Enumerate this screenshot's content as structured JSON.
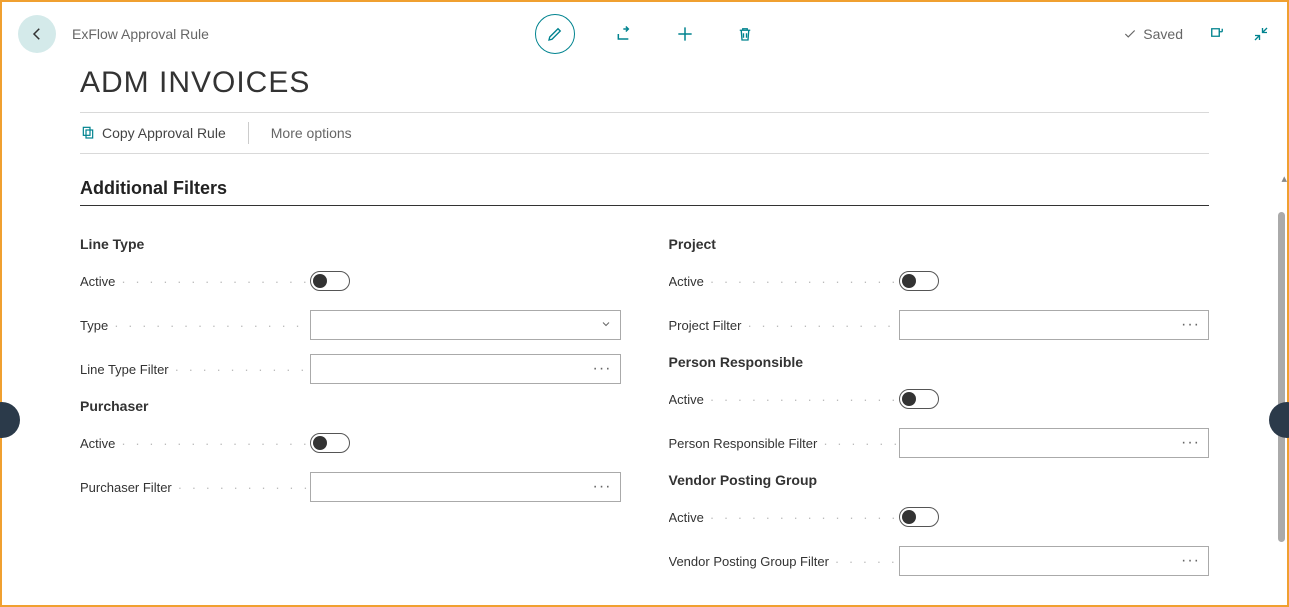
{
  "header": {
    "breadcrumb": "ExFlow Approval Rule",
    "saved_label": "Saved"
  },
  "page_title": "ADM INVOICES",
  "actions": {
    "copy_label": "Copy Approval Rule",
    "more_label": "More options"
  },
  "section": {
    "title": "Additional Filters",
    "left": {
      "group1_label": "Line Type",
      "active_label": "Active",
      "type_label": "Type",
      "type_value": "",
      "line_type_filter_label": "Line Type Filter",
      "line_type_filter_value": "",
      "group2_label": "Purchaser",
      "purchaser_active_label": "Active",
      "purchaser_filter_label": "Purchaser Filter",
      "purchaser_filter_value": ""
    },
    "right": {
      "group1_label": "Project",
      "active_label": "Active",
      "project_filter_label": "Project Filter",
      "project_filter_value": "",
      "group2_label": "Person Responsible",
      "pr_active_label": "Active",
      "pr_filter_label": "Person Responsible Filter",
      "pr_filter_value": "",
      "group3_label": "Vendor Posting Group",
      "vpg_active_label": "Active",
      "vpg_filter_label": "Vendor Posting Group Filter",
      "vpg_filter_value": ""
    }
  }
}
